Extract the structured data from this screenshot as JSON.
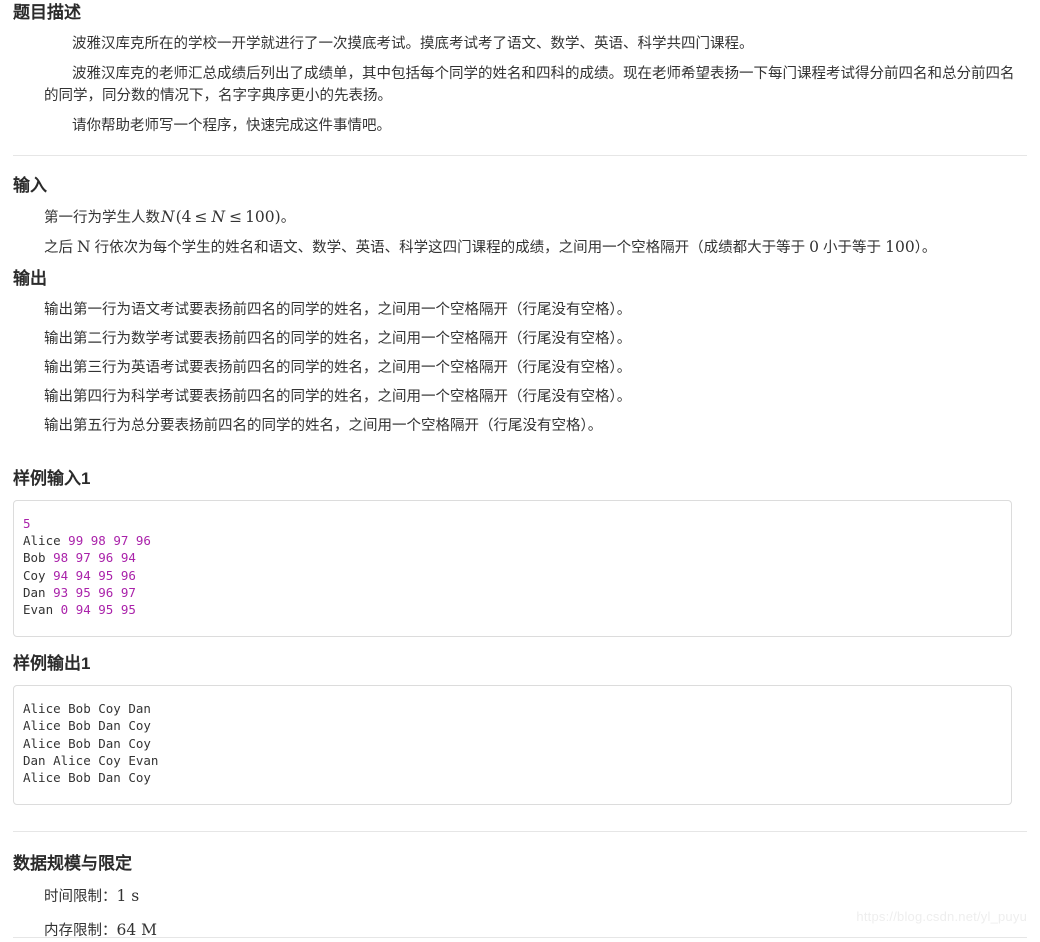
{
  "sections": {
    "description": {
      "title": "题目描述",
      "paragraphs": [
        "波雅汉库克所在的学校一开学就进行了一次摸底考试。摸底考试考了语文、数学、英语、科学共四门课程。",
        "波雅汉库克的老师汇总成绩后列出了成绩单，其中包括每个同学的姓名和四科的成绩。现在老师希望表扬一下每门课程考试得分前四名和总分前四名的同学，同分数的情况下，名字字典序更小的先表扬。",
        "请你帮助老师写一个程序，快速完成这件事情吧。"
      ]
    },
    "input": {
      "title": "输入",
      "line1_prefix": "第一行为学生人数",
      "line1_math": {
        "var": "N",
        "open": "(",
        "low": "4",
        "op1": "≤",
        "mid": "N",
        "op2": "≤",
        "high": "100",
        "close": ")"
      },
      "line1_suffix": "。",
      "line2_prefix": "之后 ",
      "line2_var": "N",
      "line2_mid": " 行依次为每个学生的姓名和语文、数学、英语、科学这四门课程的成绩，之间用一个空格隔开（成绩都大于等于 ",
      "line2_zero": "0",
      "line2_mid2": " 小于等于 ",
      "line2_hundred": "100",
      "line2_suffix": "）。"
    },
    "output": {
      "title": "输出",
      "lines": [
        "输出第一行为语文考试要表扬前四名的同学的姓名，之间用一个空格隔开（行尾没有空格）。",
        "输出第二行为数学考试要表扬前四名的同学的姓名，之间用一个空格隔开（行尾没有空格）。",
        "输出第三行为英语考试要表扬前四名的同学的姓名，之间用一个空格隔开（行尾没有空格）。",
        "输出第四行为科学考试要表扬前四名的同学的姓名，之间用一个空格隔开（行尾没有空格）。",
        "输出第五行为总分要表扬前四名的同学的姓名，之间用一个空格隔开（行尾没有空格）。"
      ]
    },
    "sample_input": {
      "title": "样例输入1",
      "count": "5",
      "rows": [
        {
          "name": "Alice",
          "scores": "99 98 97 96"
        },
        {
          "name": "Bob",
          "scores": "98 97 96 94"
        },
        {
          "name": "Coy",
          "scores": "94 94 95 96"
        },
        {
          "name": "Dan",
          "scores": "93 95 96 97"
        },
        {
          "name": "Evan",
          "scores": "0 94 95 95"
        }
      ]
    },
    "sample_output": {
      "title": "样例输出1",
      "lines": [
        "Alice Bob Coy Dan",
        "Alice Bob Dan Coy",
        "Alice Bob Dan Coy",
        "Dan Alice Coy Evan",
        "Alice Bob Dan Coy"
      ]
    },
    "limits": {
      "title": "数据规模与限定",
      "time_label": "时间限制：",
      "time_value": "1 s",
      "memory_label": "内存限制：",
      "memory_value": "64 M"
    }
  },
  "watermark": "https://blog.csdn.net/yl_puyu",
  "colors": {
    "text": "#333333",
    "heading": "#2b2b2b",
    "code_number": "#aa22aa",
    "border": "#dcdcdc",
    "rule": "#e6e6e6",
    "watermark": "#eeeeee"
  }
}
